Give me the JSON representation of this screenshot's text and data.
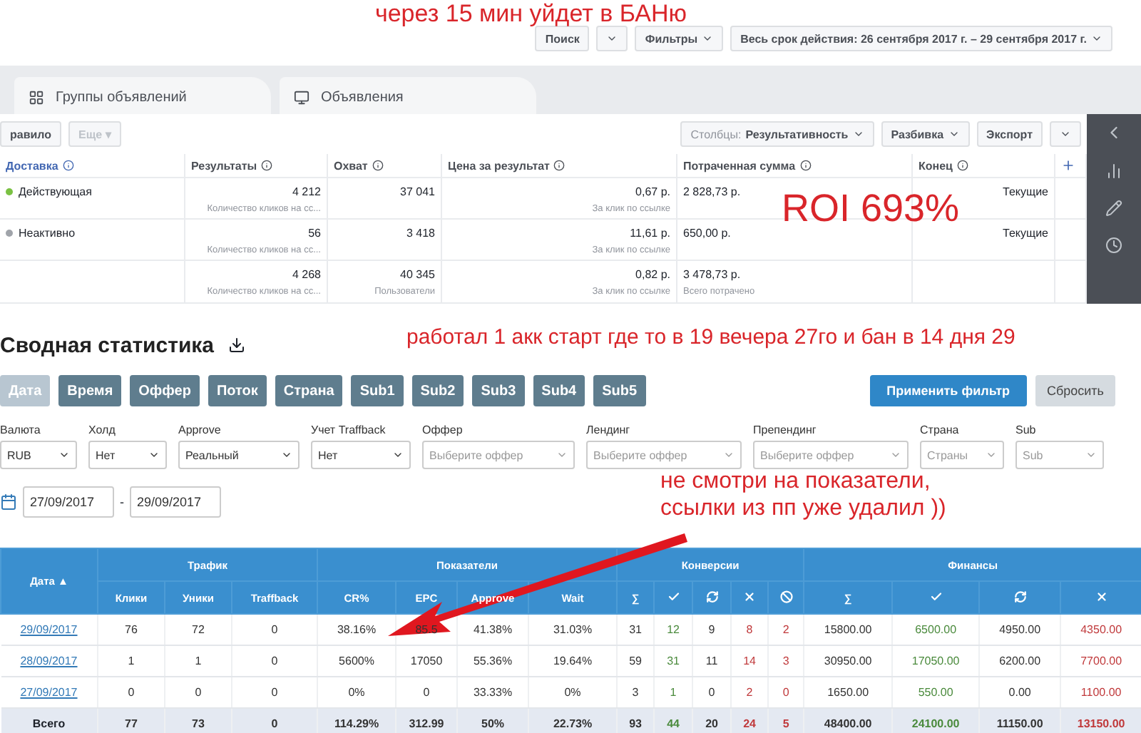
{
  "notes": [
    {
      "kind": "top",
      "text": "через 15 мин уйдет в БАНю"
    },
    {
      "kind": "roi",
      "text": "ROI 693%"
    },
    {
      "kind": "side",
      "text": "работал 1 акк старт где то в 19 вечера 27го и бан в 14 дня 29"
    },
    {
      "kind": "table",
      "text": "не смотри на показатели,\nссылки из пп уже удалил ))"
    }
  ],
  "ads": {
    "search": "Поиск",
    "filters": "Фильтры",
    "date_range": "Весь срок действия: 26 сентября 2017 г. – 29 сентября 2017 г.",
    "tabs": [
      {
        "label": "Группы объявлений",
        "selected": false
      },
      {
        "label": "Объявления",
        "selected": false
      }
    ],
    "rule": "равило",
    "more": {
      "label": "Еще ▾",
      "disabled": true
    },
    "columns_button": {
      "prefix": "Столбцы:",
      "value": "Результативность"
    },
    "breakdown": "Разбивка",
    "export": "Экспорт",
    "headers": [
      "Доставка",
      "Результаты",
      "Охват",
      "Цена за результат",
      "Потраченная сумма",
      "Конец"
    ],
    "rows": [
      {
        "status": "Действующая",
        "color": "#7ac143",
        "results": "4 212",
        "results_note": "Количество кликов на сс...",
        "reach": "37 041",
        "price": "0,67 р.",
        "price_note": "За клик по ссылке",
        "spent": "2 828,73 р.",
        "end": "Текущие"
      },
      {
        "status": "Неактивно",
        "color": "#a0a4aa",
        "results": "56",
        "results_note": "Количество кликов на сс...",
        "reach": "3 418",
        "price": "11,61 р.",
        "price_note": "За клик по ссылке",
        "spent": "650,00 р.",
        "end": "Текущие"
      }
    ],
    "total": {
      "results": "4 268",
      "results_note": "Количество кликов на сс...",
      "reach": "40 345",
      "reach_note": "Пользователи",
      "price": "0,82 р.",
      "price_note": "За клик по ссылке",
      "spent": "3 478,73 р.",
      "spent_note": "Всего потрачено"
    }
  },
  "stats": {
    "title": "Сводная статистика",
    "groupings": [
      {
        "label": "Дата",
        "selected": true
      },
      {
        "label": "Время",
        "selected": false
      },
      {
        "label": "Оффер",
        "selected": false
      },
      {
        "label": "Поток",
        "selected": false
      },
      {
        "label": "Страна",
        "selected": false
      },
      {
        "label": "Sub1",
        "selected": false
      },
      {
        "label": "Sub2",
        "selected": false
      },
      {
        "label": "Sub3",
        "selected": false
      },
      {
        "label": "Sub4",
        "selected": false
      },
      {
        "label": "Sub5",
        "selected": false
      }
    ],
    "apply": "Применить фильтр",
    "reset": "Сбросить",
    "filters": [
      {
        "label": "Валюта",
        "value": "RUB"
      },
      {
        "label": "Холд",
        "value": "Нет"
      },
      {
        "label": "Approve",
        "value": "Реальный"
      },
      {
        "label": "Учет Traffback",
        "value": "Нет"
      },
      {
        "label": "Оффер",
        "placeholder": "Выберите оффер"
      },
      {
        "label": "Лендинг",
        "placeholder": "Выберите оффер"
      },
      {
        "label": "Препендинг",
        "placeholder": "Выберите оффер"
      },
      {
        "label": "Страна",
        "placeholder": "Страны"
      },
      {
        "label": "Sub",
        "placeholder": "Sub"
      }
    ],
    "date_from": "27/09/2017",
    "date_separator": "-",
    "date_to": "29/09/2017",
    "table": {
      "date_header": "Дата ▲",
      "groups": [
        {
          "label": "Трафик",
          "columns": [
            {
              "kind": "text",
              "label": "Клики",
              "color": "#333333"
            },
            {
              "kind": "text",
              "label": "Уники",
              "color": "#333333"
            },
            {
              "kind": "text",
              "label": "Traffback",
              "color": "#333333"
            }
          ]
        },
        {
          "label": "Показатели",
          "columns": [
            {
              "kind": "text",
              "label": "CR%",
              "color": "#333333"
            },
            {
              "kind": "text",
              "label": "EPC",
              "color": "#333333"
            },
            {
              "kind": "text",
              "label": "Approve",
              "color": "#333333"
            },
            {
              "kind": "text",
              "label": "Wait",
              "color": "#333333"
            }
          ]
        },
        {
          "label": "Конверсии",
          "columns": [
            {
              "kind": "text",
              "label": "∑",
              "color": "#333333"
            },
            {
              "kind": "check",
              "color": "#4a8a3c"
            },
            {
              "kind": "refresh",
              "color": "#333333"
            },
            {
              "kind": "cross",
              "color": "#c0393b"
            },
            {
              "kind": "ban",
              "color": "#c0393b"
            }
          ]
        },
        {
          "label": "Финансы",
          "columns": [
            {
              "kind": "text",
              "label": "∑",
              "color": "#333333"
            },
            {
              "kind": "check",
              "color": "#4a8a3c"
            },
            {
              "kind": "refresh",
              "color": "#333333"
            },
            {
              "kind": "cross",
              "color": "#c0393b"
            }
          ]
        }
      ],
      "rows": [
        {
          "date": "29/09/2017",
          "cells": [
            "76",
            "72",
            "0",
            "38.16%",
            "85.5",
            "41.38%",
            "31.03%",
            "31",
            "12",
            "9",
            "8",
            "2",
            "15800.00",
            "6500.00",
            "4950.00",
            "4350.00"
          ]
        },
        {
          "date": "28/09/2017",
          "cells": [
            "1",
            "1",
            "0",
            "5600%",
            "17050",
            "55.36%",
            "19.64%",
            "59",
            "31",
            "11",
            "14",
            "3",
            "30950.00",
            "17050.00",
            "6200.00",
            "7700.00"
          ]
        },
        {
          "date": "27/09/2017",
          "cells": [
            "0",
            "0",
            "0",
            "0%",
            "0",
            "33.33%",
            "0%",
            "3",
            "1",
            "0",
            "2",
            "0",
            "1650.00",
            "550.00",
            "0.00",
            "1100.00"
          ]
        }
      ],
      "total": {
        "label": "Всего",
        "cells": [
          "77",
          "73",
          "0",
          "114.29%",
          "312.99",
          "50%",
          "22.73%",
          "93",
          "44",
          "20",
          "24",
          "5",
          "48400.00",
          "24100.00",
          "11150.00",
          "13150.00"
        ]
      }
    }
  }
}
